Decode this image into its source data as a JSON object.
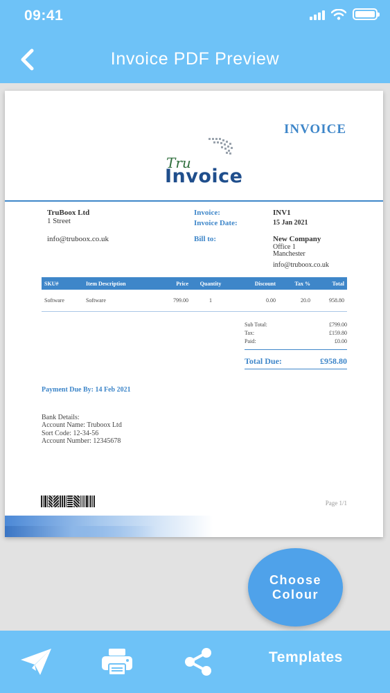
{
  "status_bar": {
    "time": "09:41"
  },
  "header": {
    "title": "Invoice PDF Preview"
  },
  "invoice": {
    "heading": "INVOICE",
    "logo": {
      "line1": "Tru",
      "line2": "Invoice"
    },
    "from": {
      "name": "TruBoox Ltd",
      "street": "1 Street",
      "email": "info@truboox.co.uk"
    },
    "meta": {
      "invoice_label": "Invoice:",
      "invoice_value": "INV1",
      "date_label": "Invoice Date:",
      "date_value": "15 Jan 2021",
      "bill_to_label": "Bill to:"
    },
    "bill_to": {
      "company": "New Company",
      "line1": "Office 1",
      "line2": "Manchester",
      "email": "info@truboox.co.uk"
    },
    "table": {
      "headers": [
        "SKU#",
        "Item Description",
        "Price",
        "Quantity",
        "Discount",
        "Tax %",
        "Total"
      ],
      "rows": [
        [
          "Software",
          "Software",
          "799.00",
          "1",
          "0.00",
          "20.0",
          "958.80"
        ]
      ]
    },
    "summary": {
      "subtotal_label": "Sub Total:",
      "subtotal_value": "£799.00",
      "tax_label": "Tax:",
      "tax_value": "£159.80",
      "paid_label": "Paid:",
      "paid_value": "£0.00",
      "total_label": "Total Due:",
      "total_value": "£958.80"
    },
    "payment_due": "Payment Due By: 14 Feb 2021",
    "bank": {
      "heading": "Bank Details:",
      "account_name": "Account Name: Truboox Ltd",
      "sort_code": "Sort Code: 12-34-56",
      "account_number": "Account Number: 12345678"
    },
    "page": "Page 1/1"
  },
  "fab": {
    "line1": "Choose",
    "line2": "Colour"
  },
  "bottom_bar": {
    "send_icon": "paper-plane-icon",
    "print_icon": "printer-icon",
    "share_icon": "share-icon",
    "templates_label": "Templates"
  },
  "colors": {
    "bar": "#6ec2f7",
    "accent": "#3e86c9",
    "fab": "#4fa2ea"
  }
}
